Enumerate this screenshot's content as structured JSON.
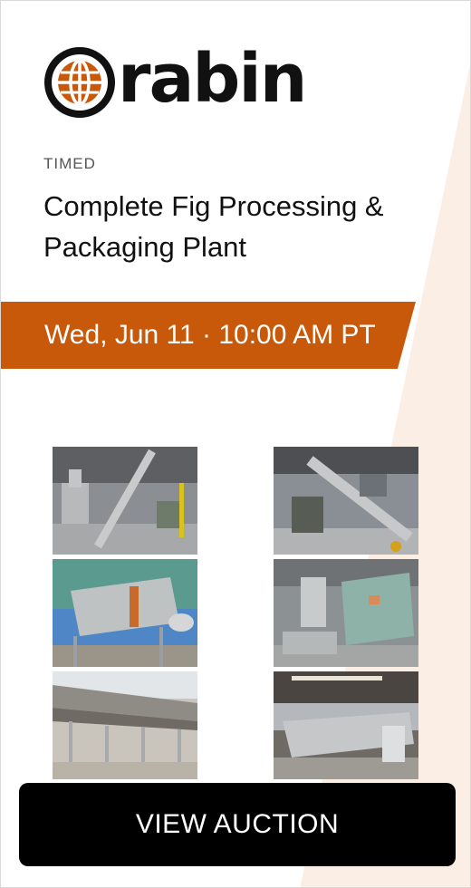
{
  "brand": {
    "wordmark": "rabin",
    "accent_color": "#c8590a"
  },
  "auction": {
    "type": "TIMED",
    "title": "Complete Fig Processing & Packaging Plant",
    "date_time": "Wed, Jun 11 · 10:00 AM PT"
  },
  "photos": [
    {
      "name": "photo-1",
      "icon": "bagging-machine-with-incline-conveyor"
    },
    {
      "name": "photo-2",
      "icon": "incline-conveyor-and-bagger"
    },
    {
      "name": "photo-3",
      "icon": "steel-hopper-outdoors"
    },
    {
      "name": "photo-4",
      "icon": "stainless-processing-machine"
    },
    {
      "name": "photo-5",
      "icon": "steel-conveyor-frame-outdoors"
    },
    {
      "name": "photo-6",
      "icon": "sorting-line-in-warehouse"
    }
  ],
  "cta": {
    "label": "VIEW AUCTION"
  }
}
